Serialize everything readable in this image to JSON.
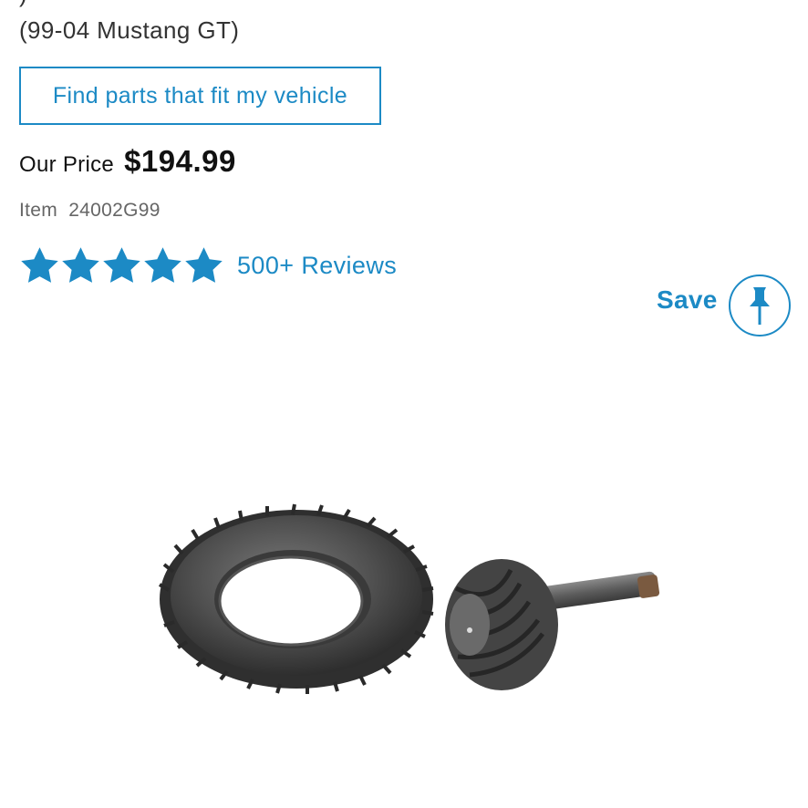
{
  "product": {
    "title_partial": ")",
    "fitment": "(99-04 Mustang GT)",
    "fit_button_label": "Find parts that fit my vehicle",
    "price_label": "Our Price",
    "price": "$194.99",
    "item_label": "Item",
    "item_number": "24002G99",
    "rating_stars": 5,
    "rating_max": 5,
    "reviews_label": "500+ Reviews",
    "save_label": "Save"
  },
  "icons": {
    "star": "star-icon",
    "pin": "pin-icon"
  },
  "colors": {
    "accent": "#1c8ac5",
    "text": "#111111",
    "muted": "#666666"
  }
}
